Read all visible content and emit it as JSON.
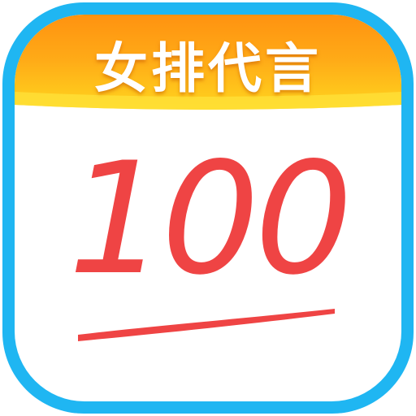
{
  "icon": {
    "title": "女排代言",
    "score": "100",
    "colors": {
      "frame": "#1fb6f2",
      "card": "#ffffff",
      "banner_top": "#ff9a10",
      "banner_bottom": "#ffd21c",
      "title": "#ffffff",
      "score": "#ef4444"
    }
  }
}
